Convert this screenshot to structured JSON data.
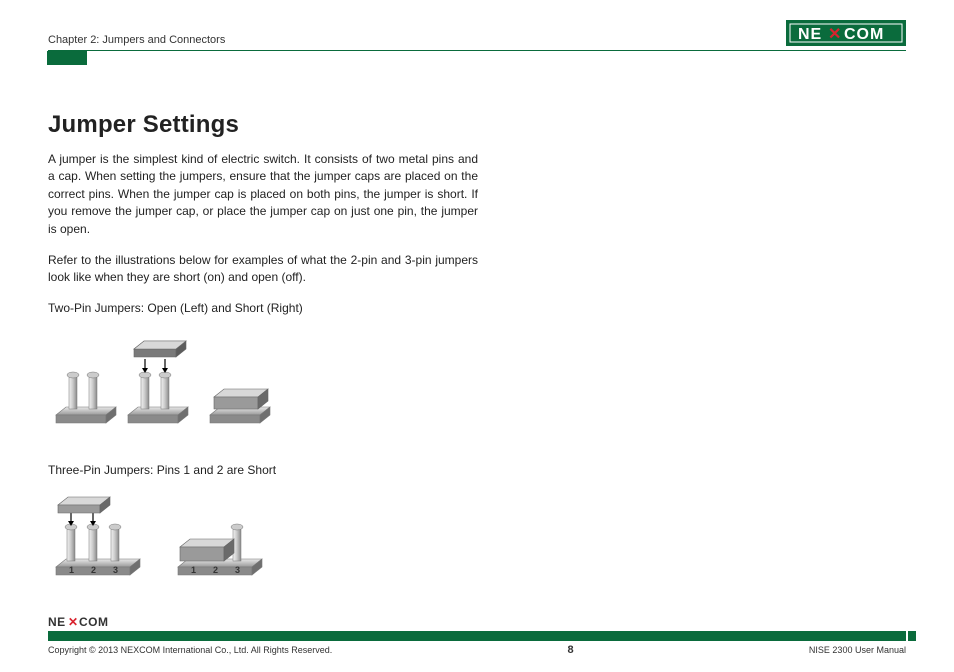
{
  "brand": {
    "name": "NEXCOM",
    "x_color": "#d9232e",
    "bg": "#0a6b3c"
  },
  "header": {
    "chapter": "Chapter 2: Jumpers and Connectors"
  },
  "main": {
    "title": "Jumper Settings",
    "paragraph1": "A jumper is the simplest kind of electric switch. It consists of two metal pins and a cap. When setting the jumpers, ensure that the jumper caps are placed on the correct pins. When the jumper cap is placed on both pins, the jumper is short. If you remove the jumper cap, or place the jumper cap on just one pin, the jumper is open.",
    "paragraph2": "Refer to the illustrations below for examples of what the 2-pin and 3-pin jumpers look like when they are short (on) and open (off).",
    "caption1": "Two-Pin Jumpers: Open (Left) and Short (Right)",
    "caption2": "Three-Pin Jumpers: Pins 1 and 2 are Short",
    "pin_labels": {
      "p1": "1",
      "p2": "2",
      "p3": "3"
    }
  },
  "footer": {
    "copyright": "Copyright © 2013 NEXCOM International Co., Ltd. All Rights Reserved.",
    "page": "8",
    "manual": "NISE 2300 User Manual"
  }
}
